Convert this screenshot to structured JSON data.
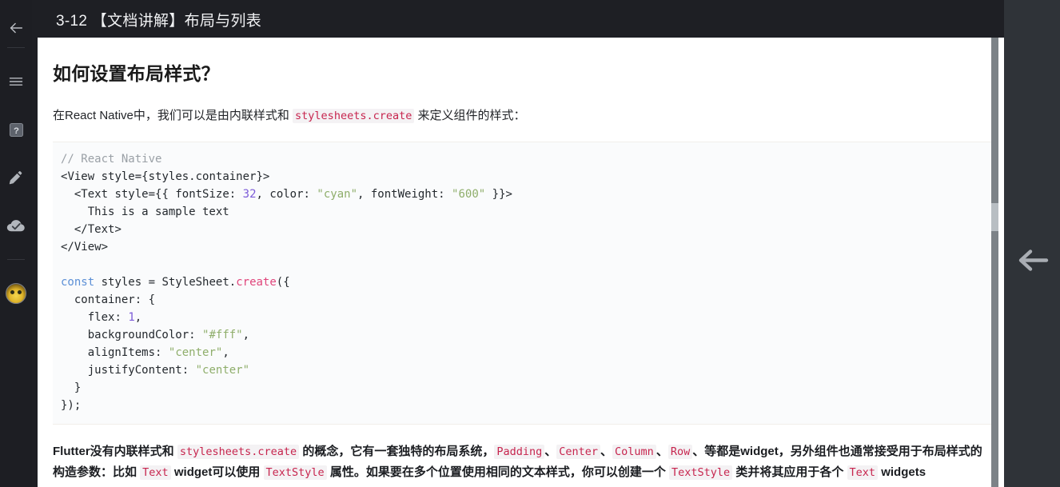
{
  "window": {
    "background_color": "#1e1f24",
    "content_background": "#ffffff"
  },
  "rail": {
    "items": [
      {
        "name": "back",
        "icon": "arrow-left-icon",
        "label": "返回"
      },
      {
        "name": "menu",
        "icon": "hamburger-menu-icon",
        "label": "菜单"
      },
      {
        "name": "help",
        "icon": "question-mark-icon",
        "label": "帮助"
      },
      {
        "name": "edit",
        "icon": "pencil-icon",
        "label": "编辑"
      },
      {
        "name": "sync",
        "icon": "cloud-check-icon",
        "label": "已同步"
      },
      {
        "name": "account",
        "icon": "avatar-icon",
        "label": "账户"
      }
    ]
  },
  "header": {
    "title": "3-12 【文档讲解】布局与列表"
  },
  "right_panel": {
    "collapse_icon": "arrow-left-icon",
    "accent_color": "#2f3338"
  },
  "document": {
    "heading": "如何设置布局样式？",
    "paragraph_1": {
      "part_1": "在React Native中，我们可以是由内联样式和 ",
      "code_1": "stylesheets.create",
      "part_2": " 来定义组件的样式："
    },
    "code_block": {
      "language": "jsx",
      "lines": [
        "// React Native",
        "<View style={styles.container}>",
        "  <Text style={{ fontSize: 32, color: \"cyan\", fontWeight: \"600\" }}>",
        "    This is a sample text",
        "  </Text>",
        "</View>",
        "",
        "const styles = StyleSheet.create({",
        "  container: {",
        "    flex: 1,",
        "    backgroundColor: \"#fff\",",
        "    alignItems: \"center\",",
        "    justifyContent: \"center\"",
        "  }",
        "});"
      ]
    },
    "paragraph_2": {
      "t1": "Flutter没有内联样式和 ",
      "c1": "stylesheets.create",
      "t2": " 的概念，它有一套独特的布局系统，",
      "c2": "Padding",
      "t3": "、",
      "c3": "Center",
      "t4": "、",
      "c4": "Column",
      "t5": "、",
      "c5": "Row",
      "t6": "、等都是widget，另外组件也通常接受用于布局样式的构造参数：比如 ",
      "c6": "Text",
      "t7": " widget可以使用 ",
      "c7": "TextStyle",
      "t8": " 属性。如果要在多个位置使用相同的文本样式，你可以创建一个 ",
      "c8": "TextStyle",
      "t9": " 类并将其应用于各个 ",
      "c9": "Text",
      "t10": " widgets"
    }
  },
  "scrollbar": {
    "orientation": "vertical",
    "track_color": "#7c8287",
    "thumb_color": "#b8bec3"
  },
  "colors": {
    "inline_code_text": "#c7254e",
    "inline_code_bg": "#f4f2f4",
    "code_block_bg": "#fafbfc"
  }
}
